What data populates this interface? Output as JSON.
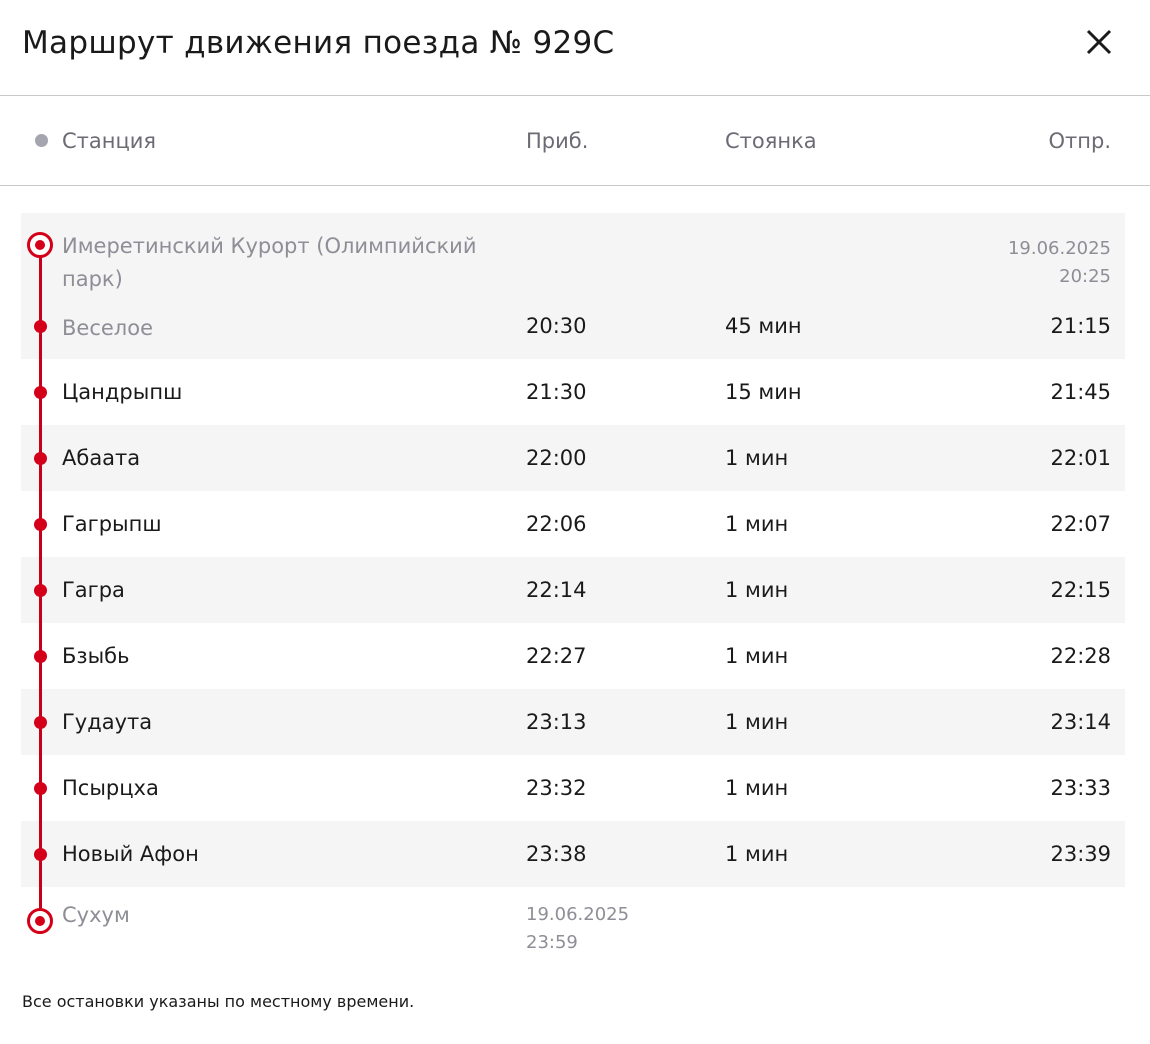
{
  "header": {
    "title": "Маршрут движения поезда № 929С",
    "close_icon": "close-icon"
  },
  "columns": {
    "station": "Станция",
    "arrival": "Приб.",
    "stop": "Стоянка",
    "departure": "Отпр."
  },
  "origin": {
    "station": "Имеретинский Курорт (Олимпийский парк)",
    "departure_date": "19.06.2025",
    "departure_time": "20:25"
  },
  "stops": [
    {
      "station": "Веселое",
      "arrival": "20:30",
      "stop": "45 мин",
      "departure": "21:15"
    },
    {
      "station": "Цандрыпш",
      "arrival": "21:30",
      "stop": "15 мин",
      "departure": "21:45"
    },
    {
      "station": "Абаата",
      "arrival": "22:00",
      "stop": "1 мин",
      "departure": "22:01"
    },
    {
      "station": "Гагрыпш",
      "arrival": "22:06",
      "stop": "1 мин",
      "departure": "22:07"
    },
    {
      "station": "Гагра",
      "arrival": "22:14",
      "stop": "1 мин",
      "departure": "22:15"
    },
    {
      "station": "Бзыбь",
      "arrival": "22:27",
      "stop": "1 мин",
      "departure": "22:28"
    },
    {
      "station": "Гудаута",
      "arrival": "23:13",
      "stop": "1 мин",
      "departure": "23:14"
    },
    {
      "station": "Псырцха",
      "arrival": "23:32",
      "stop": "1 мин",
      "departure": "23:33"
    },
    {
      "station": "Новый Афон",
      "arrival": "23:38",
      "stop": "1 мин",
      "departure": "23:39"
    }
  ],
  "destination": {
    "station": "Сухум",
    "arrival_date": "19.06.2025",
    "arrival_time": "23:59"
  },
  "footer": {
    "note": "Все остановки указаны по местному времени."
  },
  "colors": {
    "accent": "#d4001a",
    "muted": "#8e8e96",
    "row_shade": "#f5f5f6"
  }
}
